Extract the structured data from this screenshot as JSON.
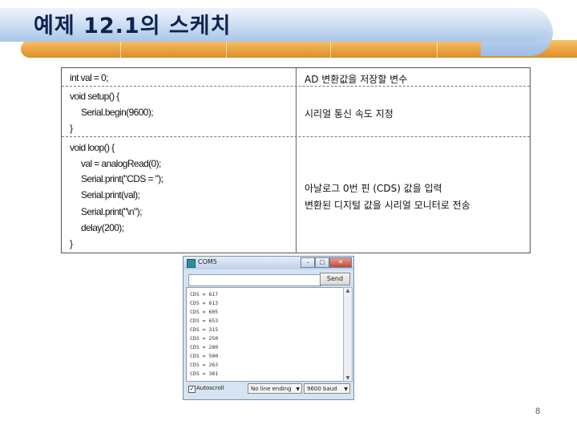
{
  "slide": {
    "title": "예제 12.1의 스케치",
    "page_number": "8"
  },
  "code_table": {
    "rows": [
      {
        "code": [
          "int val = 0;"
        ],
        "comment": [
          "AD 변환값을 저장할 변수"
        ]
      },
      {
        "code": [
          "void setup() {",
          "Serial.begin(9600);",
          "}"
        ],
        "comment": [
          "시리얼 통신 속도 지정"
        ]
      },
      {
        "code": [
          "void loop() {",
          "val = analogRead(0);",
          "Serial.print(\"CDS = \");",
          "Serial.print(val);",
          "Serial.print(\"\\n\");",
          "delay(200);",
          "}"
        ],
        "comment": [
          "아날로그 0번 핀 (CDS) 값을 입력",
          "변환된 디지털 값을 시리얼 모니터로 전송"
        ]
      }
    ]
  },
  "serial_monitor": {
    "window_title": "COM5",
    "window_buttons": {
      "minimize": "–",
      "maximize": "□",
      "close": "✕"
    },
    "send_input_value": "",
    "send_label": "Send",
    "output_lines": [
      "CDS = 617",
      "CDS = 613",
      "CDS = 605",
      "CDS = 653",
      "CDS = 315",
      "CDS = 250",
      "CDS = 280",
      "CDS = 500",
      "CDS = 263",
      "CDS = 381"
    ],
    "autoscroll_label": "Autoscroll",
    "autoscroll_checked": "✓",
    "line_ending_value": "No line ending",
    "baud_value": "9600 baud",
    "icons": [
      "app-icon",
      "minimize-icon",
      "maximize-icon",
      "close-icon",
      "scroll-up-icon",
      "scroll-down-icon",
      "chevron-down-icon"
    ]
  },
  "colors": {
    "title_text": "#0f2350",
    "banner_blue": "#a9c6e8",
    "banner_gold": "#e9a13f"
  }
}
